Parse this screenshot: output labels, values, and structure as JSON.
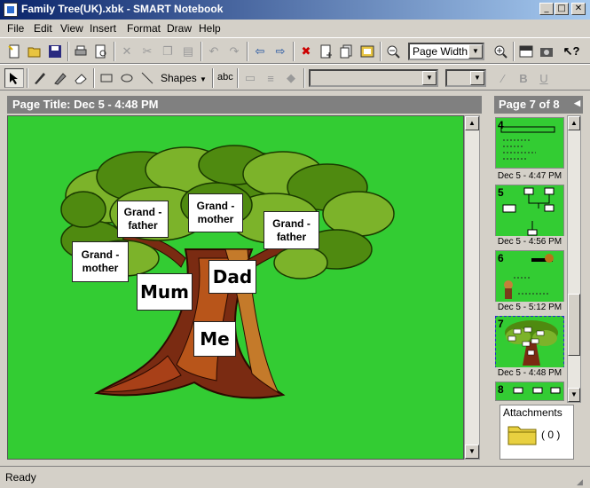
{
  "window": {
    "title": "Family Tree(UK).xbk - SMART Notebook",
    "controls": [
      "_",
      "□",
      "✕"
    ]
  },
  "menus": [
    "File",
    "Edit",
    "View",
    "Insert",
    "Format",
    "Draw",
    "Help"
  ],
  "toolbar1": {
    "zoom_select": "Page Width"
  },
  "toolbar2": {
    "shapes_label": "Shapes",
    "text_tool_label": "abc",
    "bold_label": "B",
    "underline_label": "U"
  },
  "page": {
    "title": "Page Title: Dec 5 - 4:48 PM"
  },
  "canvas": {
    "labels": {
      "grand_father_left": "Grand -\nfather",
      "grand_mother_center": "Grand -\nmother",
      "grand_father_right": "Grand -\nfather",
      "grand_mother_left": "Grand -\nmother",
      "mum": "Mum",
      "dad": "Dad",
      "me": "Me"
    }
  },
  "sorter": {
    "header": "Page 7 of 8",
    "thumbnails": [
      {
        "num": "4",
        "caption": "Dec 5 - 4:47 PM"
      },
      {
        "num": "5",
        "caption": "Dec 5 - 4:56 PM"
      },
      {
        "num": "6",
        "caption": "Dec 5 - 5:12 PM"
      },
      {
        "num": "7",
        "caption": "Dec 5 - 4:48 PM"
      },
      {
        "num": "8",
        "caption": ""
      }
    ]
  },
  "attachments": {
    "label": "Attachments",
    "count": "( 0 )"
  },
  "status": "Ready",
  "colors": {
    "canvas_bg": "#33cc33",
    "title_bar": "#0a246a",
    "page_title_bar": "#808080"
  }
}
